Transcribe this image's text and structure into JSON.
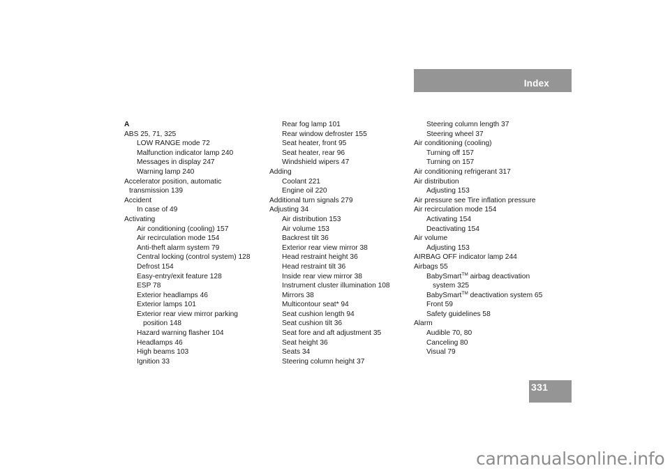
{
  "header": {
    "title": "Index"
  },
  "page": {
    "number": "331"
  },
  "section_letter": "A",
  "columns": [
    [
      {
        "level": 0,
        "text": "ABS 25, 71, 325"
      },
      {
        "level": 1,
        "text": "LOW RANGE mode 72"
      },
      {
        "level": 1,
        "text": "Malfunction indicator lamp 240"
      },
      {
        "level": 1,
        "text": "Messages in display 247"
      },
      {
        "level": 1,
        "text": "Warning lamp 240"
      },
      {
        "level": 0,
        "text": "Accelerator position, automatic"
      },
      {
        "level": "0c",
        "text": "transmission 139"
      },
      {
        "level": 0,
        "text": "Accident"
      },
      {
        "level": 1,
        "text": "In case of 49"
      },
      {
        "level": 0,
        "text": "Activating"
      },
      {
        "level": 1,
        "text": "Air conditioning (cooling) 157"
      },
      {
        "level": 1,
        "text": "Air recirculation mode 154"
      },
      {
        "level": 1,
        "text": "Anti-theft alarm system 79"
      },
      {
        "level": 1,
        "text": "Central locking (control system) 128"
      },
      {
        "level": 1,
        "text": "Defrost 154"
      },
      {
        "level": 1,
        "text": "Easy-entry/exit feature 128"
      },
      {
        "level": 1,
        "text": "ESP 78"
      },
      {
        "level": 1,
        "text": "Exterior headlamps 46"
      },
      {
        "level": 1,
        "text": "Exterior lamps 101"
      },
      {
        "level": 1,
        "text": "Exterior rear view mirror parking"
      },
      {
        "level": "1c",
        "text": "position 148"
      },
      {
        "level": 1,
        "text": "Hazard warning flasher 104"
      },
      {
        "level": 1,
        "text": "Headlamps 46"
      },
      {
        "level": 1,
        "text": "High beams 103"
      },
      {
        "level": 1,
        "text": "Ignition 33"
      }
    ],
    [
      {
        "level": 1,
        "text": "Rear fog lamp 101"
      },
      {
        "level": 1,
        "text": "Rear window defroster 155"
      },
      {
        "level": 1,
        "text": "Seat heater, front 95"
      },
      {
        "level": 1,
        "text": "Seat heater, rear 96"
      },
      {
        "level": 1,
        "text": "Windshield wipers 47"
      },
      {
        "level": 0,
        "text": "Adding"
      },
      {
        "level": 1,
        "text": "Coolant 221"
      },
      {
        "level": 1,
        "text": "Engine oil 220"
      },
      {
        "level": 0,
        "text": "Additional turn signals 279"
      },
      {
        "level": 0,
        "text": "Adjusting 34"
      },
      {
        "level": 1,
        "text": "Air distribution 153"
      },
      {
        "level": 1,
        "text": "Air volume 153"
      },
      {
        "level": 1,
        "text": "Backrest tilt 36"
      },
      {
        "level": 1,
        "text": "Exterior rear view mirror 38"
      },
      {
        "level": 1,
        "text": "Head restraint height 36"
      },
      {
        "level": 1,
        "text": "Head restraint tilt 36"
      },
      {
        "level": 1,
        "text": "Inside rear view mirror 38"
      },
      {
        "level": 1,
        "text": "Instrument cluster illumination 108"
      },
      {
        "level": 1,
        "text": "Mirrors 38"
      },
      {
        "level": 1,
        "text": "Multicontour seat* 94"
      },
      {
        "level": 1,
        "text": "Seat cushion length 94"
      },
      {
        "level": 1,
        "text": "Seat cushion tilt 36"
      },
      {
        "level": 1,
        "text": "Seat fore and aft adjustment 35"
      },
      {
        "level": 1,
        "text": "Seat height 36"
      },
      {
        "level": 1,
        "text": "Seats 34"
      },
      {
        "level": 1,
        "text": "Steering column height 37"
      }
    ],
    [
      {
        "level": 1,
        "text": "Steering column length 37"
      },
      {
        "level": 1,
        "text": "Steering wheel 37"
      },
      {
        "level": 0,
        "text": "Air conditioning (cooling)"
      },
      {
        "level": 1,
        "text": "Turning off 157"
      },
      {
        "level": 1,
        "text": "Turning on 157"
      },
      {
        "level": 0,
        "text": "Air conditioning refrigerant 317"
      },
      {
        "level": 0,
        "text": "Air distribution"
      },
      {
        "level": 1,
        "text": "Adjusting 153"
      },
      {
        "level": 0,
        "text": "Air pressure see Tire inflation pressure"
      },
      {
        "level": 0,
        "text": "Air recirculation mode 154"
      },
      {
        "level": 1,
        "text": "Activating 154"
      },
      {
        "level": 1,
        "text": "Deactivating 154"
      },
      {
        "level": 0,
        "text": "Air volume"
      },
      {
        "level": 1,
        "text": "Adjusting 153"
      },
      {
        "level": 0,
        "text": "AIRBAG OFF indicator lamp 244"
      },
      {
        "level": 0,
        "text": "Airbags 55"
      },
      {
        "level": 1,
        "text": "BabySmart",
        "sup": "TM",
        "after": " airbag deactivation"
      },
      {
        "level": "1c",
        "text": "system 325"
      },
      {
        "level": 1,
        "text": "BabySmart",
        "sup": "TM",
        "after": " deactivation system 65"
      },
      {
        "level": 1,
        "text": "Front 59"
      },
      {
        "level": 1,
        "text": "Safety guidelines 58"
      },
      {
        "level": 0,
        "text": "Alarm"
      },
      {
        "level": 1,
        "text": "Audible 70, 80"
      },
      {
        "level": 1,
        "text": "Canceling 80"
      },
      {
        "level": 1,
        "text": "Visual 79"
      }
    ]
  ],
  "watermark": "carmanualsonline.info"
}
